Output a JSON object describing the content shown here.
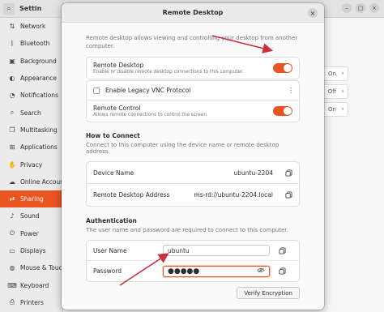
{
  "settings": {
    "title": "Settin",
    "sidebar": [
      {
        "label": "Network",
        "icon": "network-icon",
        "glyph": "⇅"
      },
      {
        "label": "Bluetooth",
        "icon": "bluetooth-icon",
        "glyph": "ᛒ"
      },
      {
        "label": "Background",
        "icon": "background-icon",
        "glyph": "▣"
      },
      {
        "label": "Appearance",
        "icon": "appearance-icon",
        "glyph": "◐"
      },
      {
        "label": "Notifications",
        "icon": "notifications-icon",
        "glyph": "◔"
      },
      {
        "label": "Search",
        "icon": "search-icon",
        "glyph": "⌕"
      },
      {
        "label": "Multitasking",
        "icon": "multitasking-icon",
        "glyph": "❐"
      },
      {
        "label": "Applications",
        "icon": "applications-icon",
        "glyph": "⊞"
      },
      {
        "label": "Privacy",
        "icon": "privacy-icon",
        "glyph": "✋"
      },
      {
        "label": "Online Account",
        "icon": "online-accounts-icon",
        "glyph": "☁"
      },
      {
        "label": "Sharing",
        "icon": "sharing-icon",
        "glyph": "⇄",
        "active": true
      },
      {
        "label": "Sound",
        "icon": "sound-icon",
        "glyph": "♪"
      },
      {
        "label": "Power",
        "icon": "power-icon",
        "glyph": "⏻"
      },
      {
        "label": "Displays",
        "icon": "displays-icon",
        "glyph": "▭"
      },
      {
        "label": "Mouse & Touch",
        "icon": "mouse-icon",
        "glyph": "◍"
      },
      {
        "label": "Keyboard",
        "icon": "keyboard-icon",
        "glyph": "⌨"
      },
      {
        "label": "Printers",
        "icon": "printers-icon",
        "glyph": "⎙"
      }
    ],
    "bg_rows": [
      "On",
      "Off",
      "On"
    ]
  },
  "dialog": {
    "title": "Remote Desktop",
    "intro": "Remote desktop allows viewing and controlling your desktop from another computer.",
    "remote_desktop": {
      "label": "Remote Desktop",
      "sub": "Enable or disable remote desktop connections to this computer."
    },
    "legacy_vnc": {
      "label": "Enable Legacy VNC Protocol"
    },
    "remote_control": {
      "label": "Remote Control",
      "sub": "Allows remote connections to control the screen."
    },
    "how_to_connect": {
      "title": "How to Connect",
      "desc": "Connect to this computer using the device name or remote desktop address.",
      "device_name_label": "Device Name",
      "device_name_value": "ubuntu-2204",
      "address_label": "Remote Desktop Address",
      "address_value": "ms-rd://ubuntu-2204.local"
    },
    "authentication": {
      "title": "Authentication",
      "desc": "The user name and password are required to connect to this computer.",
      "username_label": "User Name",
      "username_value": "ubuntu",
      "password_label": "Password",
      "password_value": "●●●●●",
      "verify_button": "Verify Encryption"
    }
  },
  "colors": {
    "accent": "#e95420",
    "arrow": "#c8303a"
  }
}
